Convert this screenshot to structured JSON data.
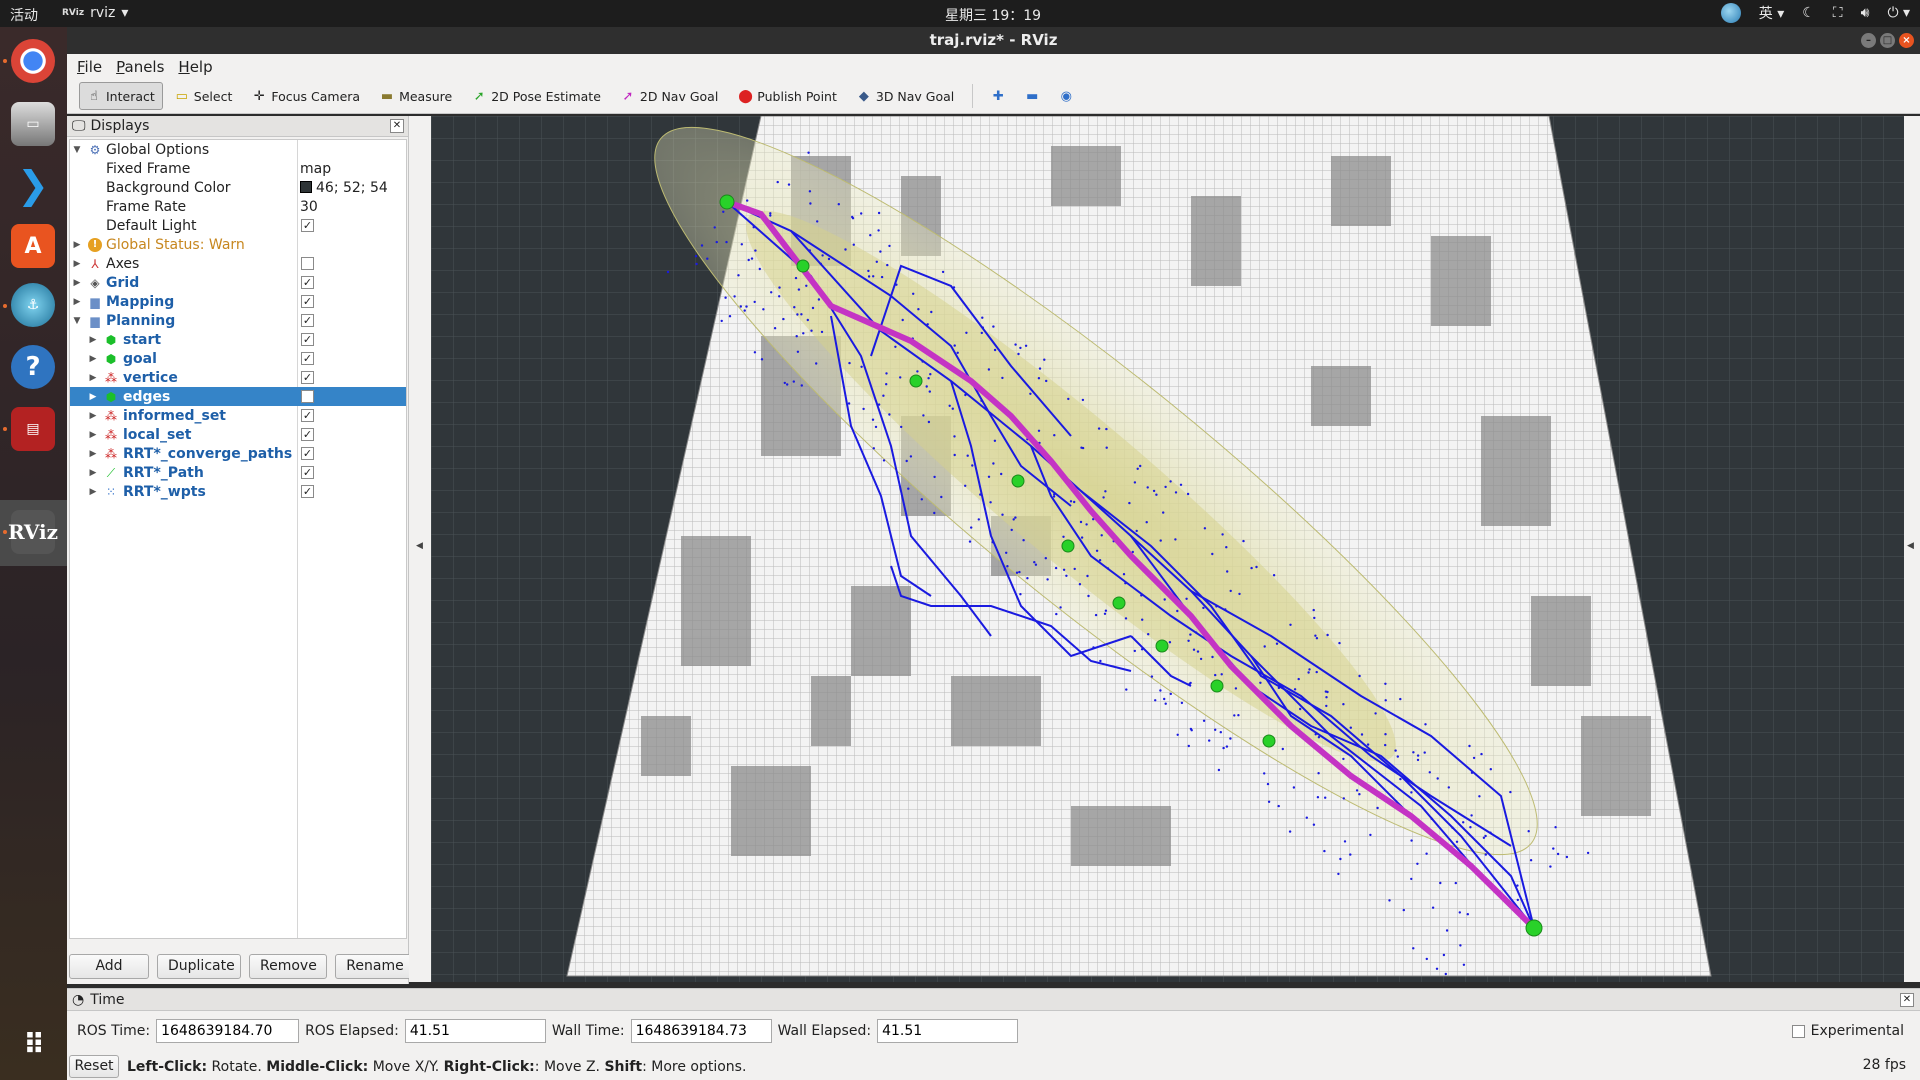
{
  "topbar": {
    "activities": "活动",
    "app_name": "rviz",
    "app_mini_icon": "RViz",
    "clock": "星期三 19：19",
    "ime": "英"
  },
  "window": {
    "title": "traj.rviz* - RViz"
  },
  "menu": [
    "File",
    "Panels",
    "Help"
  ],
  "toolbar": {
    "interact": "Interact",
    "select": "Select",
    "focus_camera": "Focus Camera",
    "measure": "Measure",
    "pose_estimate": "2D Pose Estimate",
    "nav_goal": "2D Nav Goal",
    "publish_point": "Publish Point",
    "nav_goal_3d": "3D Nav Goal"
  },
  "displays_panel": {
    "title": "Displays",
    "global_options": "Global Options",
    "fixed_frame_label": "Fixed Frame",
    "fixed_frame_value": "map",
    "bg_color_label": "Background Color",
    "bg_color_value": "46; 52; 54",
    "frame_rate_label": "Frame Rate",
    "frame_rate_value": "30",
    "default_light_label": "Default Light",
    "global_status": "Global Status: Warn",
    "axes": "Axes",
    "grid": "Grid",
    "mapping": "Mapping",
    "planning": "Planning",
    "start": "start",
    "goal": "goal",
    "vertice": "vertice",
    "edges": "edges",
    "informed_set": "informed_set",
    "local_set": "local_set",
    "converge_paths": "RRT*_converge_paths",
    "path": "RRT*_Path",
    "wpts": "RRT*_wpts"
  },
  "panel_buttons": {
    "add": "Add",
    "duplicate": "Duplicate",
    "remove": "Remove",
    "rename": "Rename"
  },
  "time_panel": {
    "title": "Time",
    "ros_time_label": "ROS Time:",
    "ros_time": "1648639184.70",
    "ros_elapsed_label": "ROS Elapsed:",
    "ros_elapsed": "41.51",
    "wall_time_label": "Wall Time:",
    "wall_time": "1648639184.73",
    "wall_elapsed_label": "Wall Elapsed:",
    "wall_elapsed": "41.51",
    "experimental": "Experimental"
  },
  "status": {
    "reset": "Reset",
    "left_click": "Left-Click:",
    "left_action": " Rotate. ",
    "middle_click": "Middle-Click:",
    "middle_action": " Move X/Y. ",
    "right_click": "Right-Click:",
    "right_action": ": Move Z. ",
    "shift": "Shift",
    "shift_action": ": More options.",
    "fps": "28 fps"
  },
  "colors": {
    "background": "#2e3436",
    "selection": "#3584c8",
    "path": "#1a1ae0",
    "ellipsoid": "#e8e6a0",
    "goal_marker": "#29d129",
    "accent": "#e95420"
  }
}
